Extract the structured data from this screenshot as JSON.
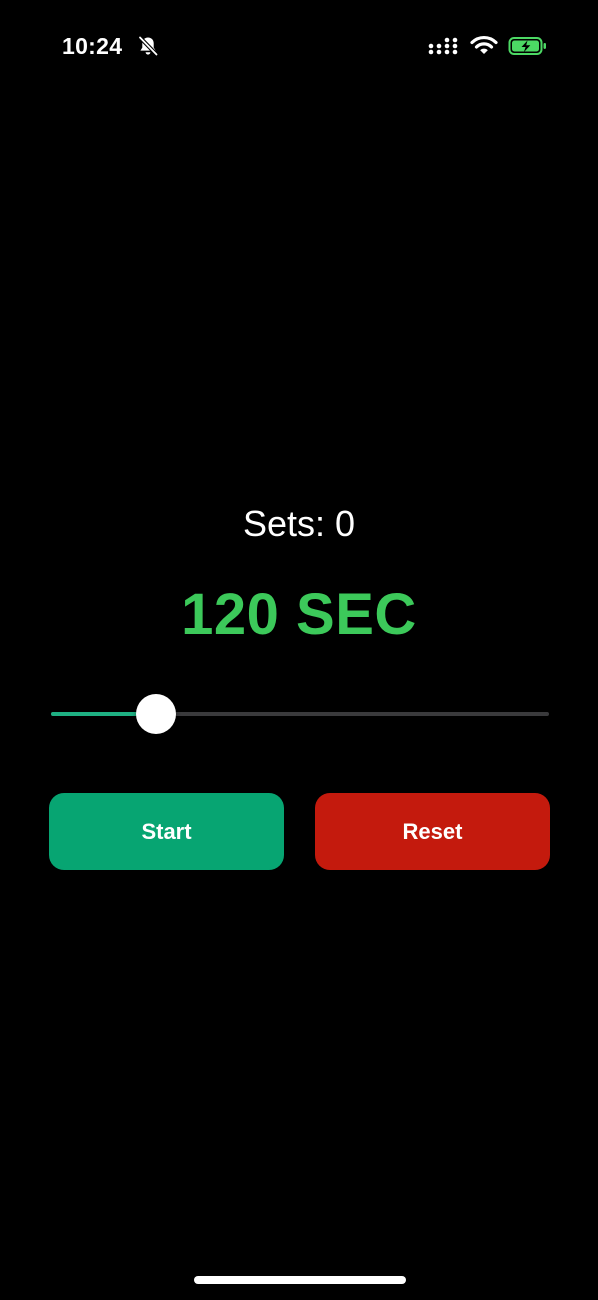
{
  "status_bar": {
    "time": "10:24",
    "icons": [
      "bell-slash-icon",
      "cellular-signal-icon",
      "wifi-icon",
      "battery-charging-icon"
    ],
    "battery_color": "#4cd964"
  },
  "workout": {
    "sets_label": "Sets: 0",
    "timer_text": "120 SEC",
    "timer_color": "#3cc95a"
  },
  "duration_slider": {
    "value_fraction": 0.21,
    "fill_color": "#1fb083",
    "track_color": "#3a3a3c"
  },
  "controls": {
    "start_label": "Start",
    "start_color": "#07a572",
    "reset_label": "Reset",
    "reset_color": "#c41a0d"
  }
}
